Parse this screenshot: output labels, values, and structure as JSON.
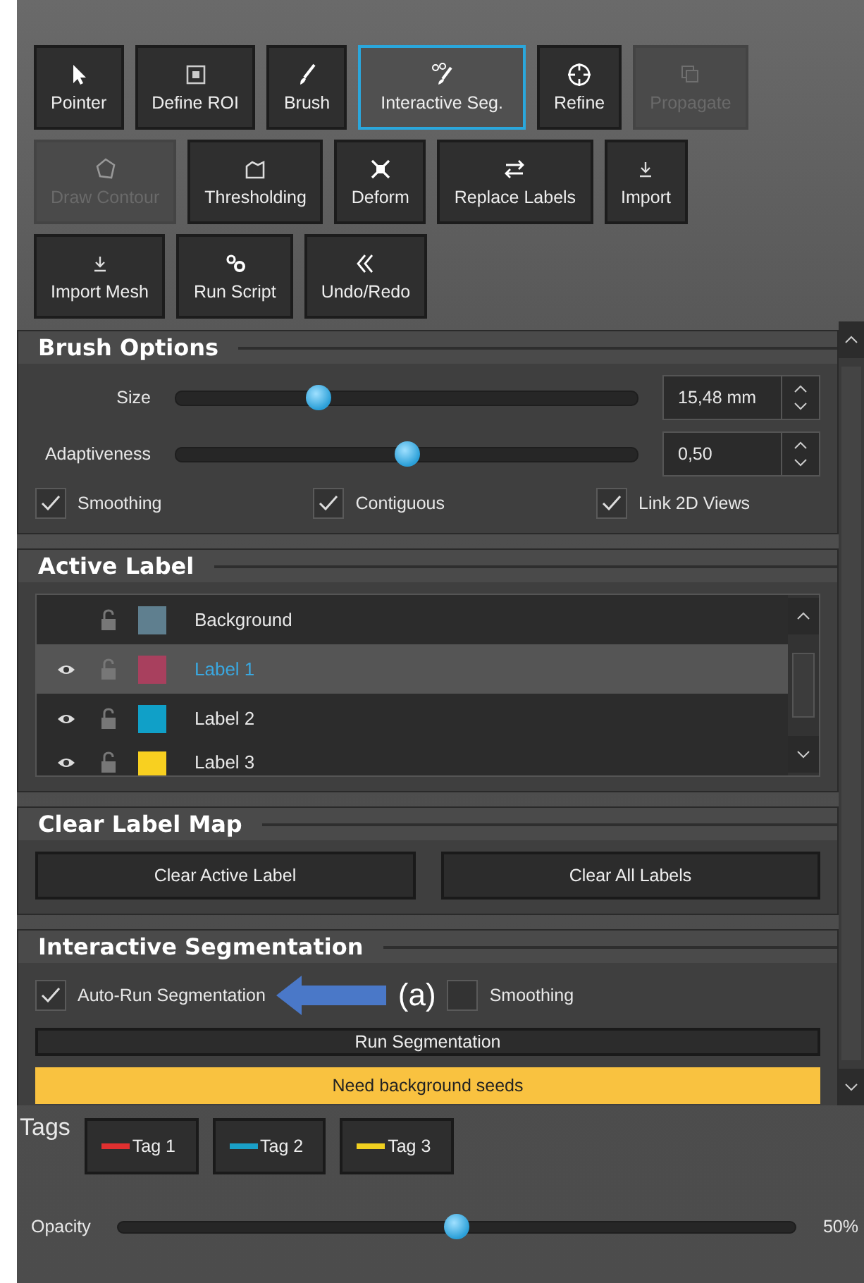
{
  "tool_rows": [
    [
      {
        "label": "Pointer",
        "selected": false,
        "disabled": false
      },
      {
        "label": "Define ROI",
        "selected": false,
        "disabled": false
      },
      {
        "label": "Brush",
        "selected": false,
        "disabled": false
      },
      {
        "label": "Interactive Seg.",
        "selected": true,
        "disabled": false
      },
      {
        "label": "Refine",
        "selected": false,
        "disabled": false
      },
      {
        "label": "Propagate",
        "selected": false,
        "disabled": true
      }
    ],
    [
      {
        "label": "Draw Contour",
        "selected": false,
        "disabled": true
      },
      {
        "label": "Thresholding",
        "selected": false,
        "disabled": false
      },
      {
        "label": "Deform",
        "selected": false,
        "disabled": false
      },
      {
        "label": "Replace Labels",
        "selected": false,
        "disabled": false
      },
      {
        "label": "Import",
        "selected": false,
        "disabled": false
      }
    ],
    [
      {
        "label": "Import Mesh",
        "selected": false,
        "disabled": false
      },
      {
        "label": "Run Script",
        "selected": false,
        "disabled": false
      },
      {
        "label": "Undo/Redo",
        "selected": false,
        "disabled": false
      }
    ]
  ],
  "brush_options": {
    "title": "Brush Options",
    "sliders": [
      {
        "label": "Size",
        "level": 0.31,
        "value": "15,48 mm"
      },
      {
        "label": "Adaptiveness",
        "level": 0.5,
        "value": "0,50"
      }
    ],
    "checkboxes": [
      {
        "label": "Smoothing",
        "checked": true
      },
      {
        "label": "Contiguous",
        "checked": true
      },
      {
        "label": "Link 2D Views",
        "checked": true
      }
    ]
  },
  "active_label": {
    "title": "Active Label",
    "labels": [
      {
        "name": "Background",
        "color": "#5f7f8f",
        "visible": false,
        "selected": false
      },
      {
        "name": "Label 1",
        "color": "#a8405e",
        "visible": true,
        "selected": true
      },
      {
        "name": "Label 2",
        "color": "#10a0c8",
        "visible": true,
        "selected": false
      },
      {
        "name": "Label 3",
        "color": "#f8d020",
        "visible": true,
        "selected": false
      }
    ]
  },
  "clear_label_map": {
    "title": "Clear Label Map",
    "buttons": [
      "Clear Active Label",
      "Clear All Labels"
    ]
  },
  "interactive_segmentation": {
    "title": "Interactive Segmentation",
    "checkboxes": [
      {
        "label": "Auto-Run Segmentation",
        "checked": true
      },
      {
        "label": "Smoothing",
        "checked": false
      }
    ],
    "annotation": "(a)",
    "run_button": "Run Segmentation",
    "status": "Need background seeds"
  },
  "tags": {
    "label": "Tags",
    "items": [
      {
        "label": "Tag 1",
        "color": "#e03030"
      },
      {
        "label": "Tag 2",
        "color": "#1aa0c8"
      },
      {
        "label": "Tag 3",
        "color": "#f0d020"
      }
    ]
  },
  "opacity": {
    "label": "Opacity",
    "level": 0.5,
    "reading": "50%"
  }
}
